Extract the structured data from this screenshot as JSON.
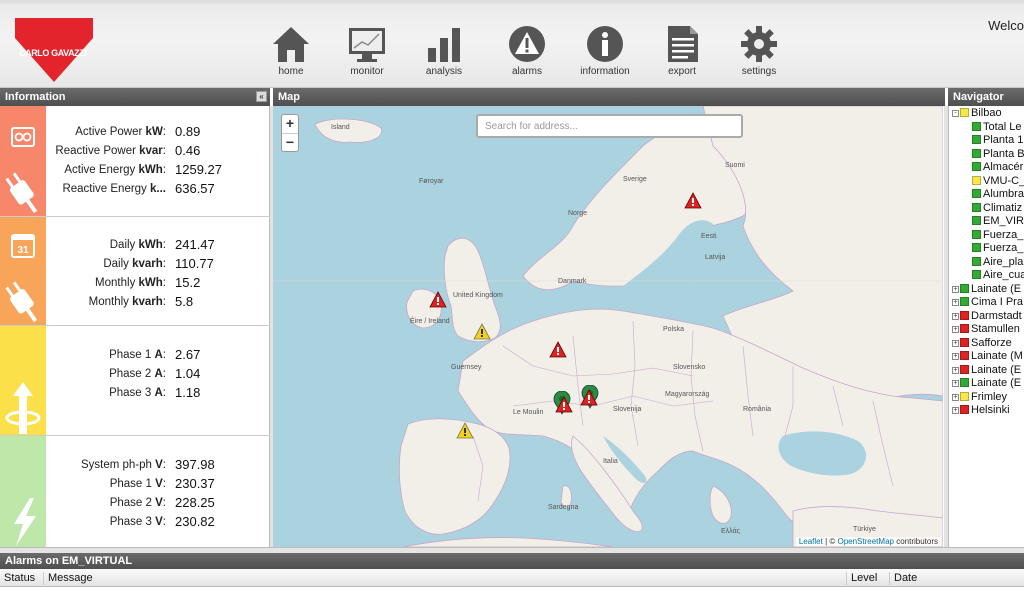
{
  "header": {
    "logo_text": "CARLO GAVAZZI",
    "welcome": "Welco",
    "nav": [
      {
        "label": "home",
        "icon": "home-icon"
      },
      {
        "label": "monitor",
        "icon": "monitor-icon"
      },
      {
        "label": "analysis",
        "icon": "bar-chart-icon"
      },
      {
        "label": "alarms",
        "icon": "warning-icon"
      },
      {
        "label": "information",
        "icon": "info-icon"
      },
      {
        "label": "export",
        "icon": "document-icon"
      },
      {
        "label": "settings",
        "icon": "gear-icon"
      }
    ]
  },
  "info": {
    "title": "Information",
    "sections": [
      {
        "color": "#f7876a",
        "rows": [
          {
            "label": "Active Power ",
            "unit": "kW",
            "suffix": ":",
            "value": "0.89"
          },
          {
            "label": "Reactive Power ",
            "unit": "kvar",
            "suffix": ":",
            "value": "0.46"
          },
          {
            "label": "Active Energy ",
            "unit": "kWh",
            "suffix": ":",
            "value": "1259.27"
          },
          {
            "label": "Reactive Energy ",
            "unit": "k...",
            "suffix": "",
            "value": "636.57"
          }
        ]
      },
      {
        "color": "#f8a55a",
        "rows": [
          {
            "label": "Daily ",
            "unit": "kWh",
            "suffix": ":",
            "value": "241.47"
          },
          {
            "label": "Daily ",
            "unit": "kvarh",
            "suffix": ":",
            "value": "110.77"
          },
          {
            "label": "Monthly ",
            "unit": "kWh",
            "suffix": ":",
            "value": "15.2"
          },
          {
            "label": "Monthly ",
            "unit": "kvarh",
            "suffix": ":",
            "value": "5.8"
          }
        ]
      },
      {
        "color": "#fbe04a",
        "rows": [
          {
            "label": "Phase 1 ",
            "unit": "A",
            "suffix": ":",
            "value": "2.67"
          },
          {
            "label": "Phase 2 ",
            "unit": "A",
            "suffix": ":",
            "value": "1.04"
          },
          {
            "label": "Phase 3 ",
            "unit": "A",
            "suffix": ":",
            "value": "1.18"
          }
        ]
      },
      {
        "color": "#bfe7a9",
        "rows": [
          {
            "label": "System ph-ph ",
            "unit": "V",
            "suffix": ":",
            "value": "397.98"
          },
          {
            "label": "Phase 1 ",
            "unit": "V",
            "suffix": ":",
            "value": "230.37"
          },
          {
            "label": "Phase 2 ",
            "unit": "V",
            "suffix": ":",
            "value": "228.25"
          },
          {
            "label": "Phase 3 ",
            "unit": "V",
            "suffix": ":",
            "value": "230.82"
          }
        ]
      }
    ]
  },
  "map": {
    "title": "Map",
    "search_placeholder": "Search for address...",
    "zoom_in": "+",
    "zoom_out": "−",
    "attribution_leaflet": "Leaflet",
    "attribution_sep": " | © ",
    "attribution_osm": "OpenStreetMap",
    "attribution_tail": " contributors",
    "labels": [
      "Island",
      "Føroyar",
      "United Kingdom",
      "Éire / Ireland",
      "Danmark",
      "Polska",
      "Norge",
      "Sverige",
      "Suomi",
      "Eesti",
      "Latvija",
      "Slovensko",
      "Slovenija",
      "Magyarország",
      "România",
      "Italia",
      "Le Moulin",
      "Guernsey",
      "Sardegna",
      "Ελλάς",
      "Türkiye"
    ]
  },
  "navigator": {
    "title": "Navigator",
    "items": [
      {
        "label": "Bilbao",
        "color": "#f5e84a",
        "level": 0,
        "expander": "-"
      },
      {
        "label": "Total Le",
        "color": "#33aa33",
        "level": 1
      },
      {
        "label": "Planta 1",
        "color": "#33aa33",
        "level": 1
      },
      {
        "label": "Planta B",
        "color": "#33aa33",
        "level": 1
      },
      {
        "label": "Almacér",
        "color": "#33aa33",
        "level": 1
      },
      {
        "label": "VMU-C_",
        "color": "#f5e84a",
        "level": 1
      },
      {
        "label": "Alumbra",
        "color": "#33aa33",
        "level": 1
      },
      {
        "label": "Climatiz",
        "color": "#33aa33",
        "level": 1
      },
      {
        "label": "EM_VIR",
        "color": "#33aa33",
        "level": 1
      },
      {
        "label": "Fuerza_",
        "color": "#33aa33",
        "level": 1
      },
      {
        "label": "Fuerza_",
        "color": "#33aa33",
        "level": 1
      },
      {
        "label": "Aire_pla",
        "color": "#33aa33",
        "level": 1
      },
      {
        "label": "Aire_cua",
        "color": "#33aa33",
        "level": 1
      },
      {
        "label": "Lainate (E",
        "color": "#33aa33",
        "level": 0,
        "expander": "+"
      },
      {
        "label": "Cima I Pra",
        "color": "#33aa33",
        "level": 0,
        "expander": "+"
      },
      {
        "label": "Darmstadt",
        "color": "#dd2222",
        "level": 0,
        "expander": "+"
      },
      {
        "label": "Stamullen",
        "color": "#dd2222",
        "level": 0,
        "expander": "+"
      },
      {
        "label": "Safforze",
        "color": "#dd2222",
        "level": 0,
        "expander": "+"
      },
      {
        "label": "Lainate (M",
        "color": "#dd2222",
        "level": 0,
        "expander": "+"
      },
      {
        "label": "Lainate (E",
        "color": "#dd2222",
        "level": 0,
        "expander": "+"
      },
      {
        "label": "Lainate (E",
        "color": "#33aa33",
        "level": 0,
        "expander": "+"
      },
      {
        "label": "Frimley",
        "color": "#f5e84a",
        "level": 0,
        "expander": "+"
      },
      {
        "label": "Helsinki",
        "color": "#dd2222",
        "level": 0,
        "expander": "+"
      }
    ]
  },
  "alarms": {
    "title": "Alarms on EM_VIRTUAL",
    "columns": [
      "Status",
      "Message",
      "Level",
      "Date"
    ]
  },
  "markers": [
    {
      "type": "warning",
      "color": "#dd2222",
      "name": "helsinki-marker"
    },
    {
      "type": "warning",
      "color": "#dd2222",
      "name": "stamullen-marker"
    },
    {
      "type": "warning",
      "color": "#f2d21a",
      "name": "frimley-marker"
    },
    {
      "type": "warning",
      "color": "#dd2222",
      "name": "darmstadt-marker"
    },
    {
      "type": "warning",
      "color": "#dd2222",
      "name": "lainate-marker"
    },
    {
      "type": "pin",
      "color": "#2e8b3e",
      "name": "cima-marker"
    },
    {
      "type": "warning",
      "color": "#dd2222",
      "name": "safforze-marker"
    },
    {
      "type": "pin",
      "color": "#2e8b3e",
      "name": "safforze-pin"
    },
    {
      "type": "warning",
      "color": "#f2d21a",
      "name": "bilbao-marker"
    }
  ]
}
